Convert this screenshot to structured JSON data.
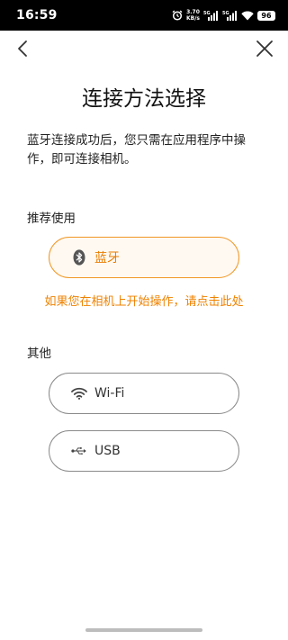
{
  "status_bar": {
    "time": "16:59",
    "net_speed_value": "3.70",
    "net_speed_unit": "KB/s",
    "battery": "96",
    "icons": [
      "alarm-icon",
      "signal-5g-icon",
      "signal-5g-icon",
      "wifi-icon",
      "battery-icon"
    ]
  },
  "nav": {
    "back_icon": "chevron-left-icon",
    "close_icon": "close-icon"
  },
  "page": {
    "title": "连接方法选择",
    "description": "蓝牙连接成功后，您只需在应用程序中操作，即可连接相机。"
  },
  "recommended": {
    "title": "推荐使用",
    "bluetooth_label": "蓝牙",
    "hint": "如果您在相机上开始操作，请点击此处"
  },
  "other": {
    "title": "其他",
    "wifi_label": "Wi-Fi",
    "usb_label": "USB"
  },
  "colors": {
    "accent": "#ef8200",
    "accent_border": "#f09826",
    "pill_border": "#8a8a8a",
    "status_bar_bg": "#000000"
  }
}
